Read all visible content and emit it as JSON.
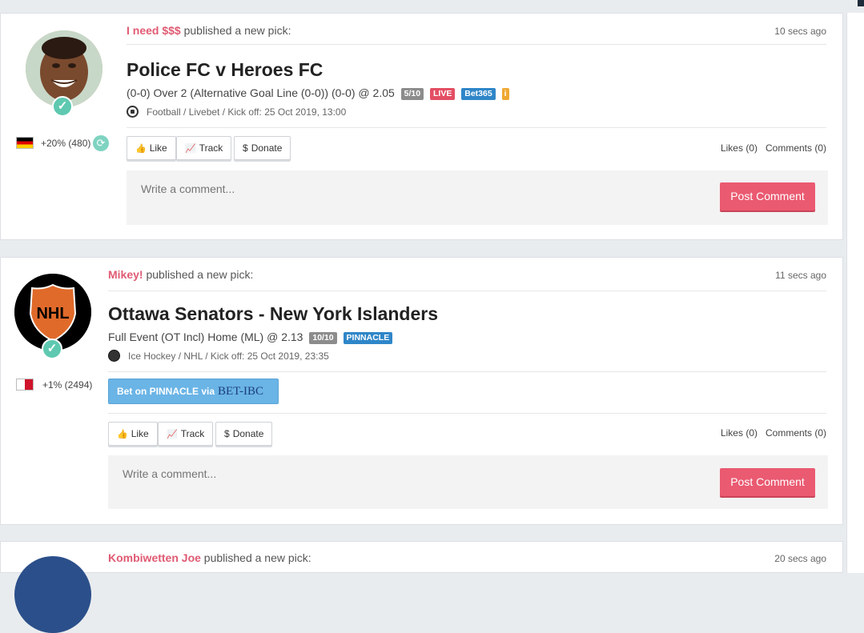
{
  "feed": [
    {
      "username": "I need $$$",
      "action_text": "published a new pick:",
      "time": "10 secs ago",
      "title": "Police FC v Heroes FC",
      "pick": "(0-0) Over 2 (Alternative Goal Line (0-0)) (0-0) @ 2.05",
      "badges": {
        "rating": "5/10",
        "live": "LIVE",
        "bookie": "Bet365",
        "info": "i"
      },
      "meta": "Football / Livebet / Kick off: 25 Oct 2019, 13:00",
      "sport_icon": "soccer-ball-icon",
      "flag_icon": "germany-flag-icon",
      "stats": "+20% (480)",
      "like_label": "Like",
      "track_label": "Track",
      "donate_label": "Donate",
      "likes": "Likes (0)",
      "comments": "Comments (0)",
      "comment_placeholder": "Write a comment...",
      "post_label": "Post Comment"
    },
    {
      "username": "Mikey!",
      "action_text": "published a new pick:",
      "time": "11 secs ago",
      "title": "Ottawa Senators - New York Islanders",
      "pick": "Full Event (OT Incl) Home (ML) @ 2.13",
      "badges": {
        "rating": "10/10",
        "bookie": "PINNACLE"
      },
      "meta": "Ice Hockey / NHL / Kick off: 25 Oct 2019, 23:35",
      "sport_icon": "hockey-puck-icon",
      "flag_icon": "malta-flag-icon",
      "stats": "+1% (2494)",
      "bet_button": "Bet on PINNACLE via",
      "bet_logo": "BET-IBC",
      "like_label": "Like",
      "track_label": "Track",
      "donate_label": "Donate",
      "likes": "Likes (0)",
      "comments": "Comments (0)",
      "comment_placeholder": "Write a comment...",
      "post_label": "Post Comment"
    },
    {
      "username": "Kombiwetten Joe",
      "action_text": "published a new pick:",
      "time": "20 secs ago"
    }
  ],
  "colors": {
    "accent": "#ea5a71",
    "username": "#e05a73",
    "verified": "#5ec9b0",
    "live": "#e34f63",
    "bookie": "#2f86c8"
  }
}
